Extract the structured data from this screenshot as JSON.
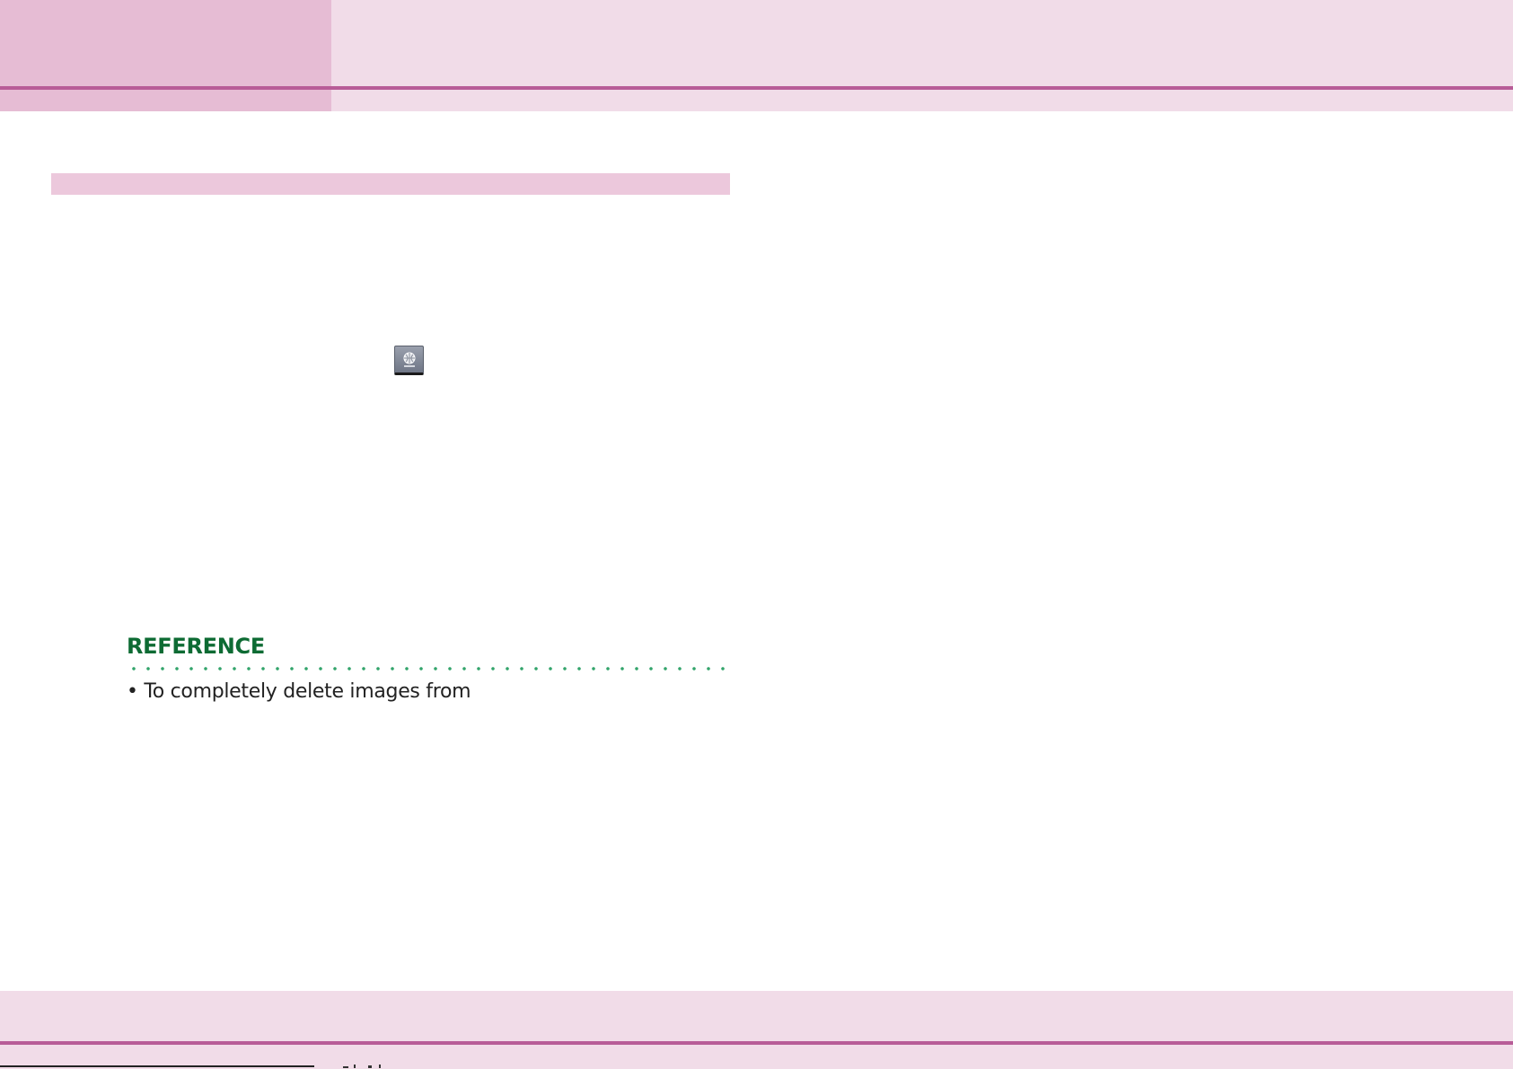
{
  "reference": {
    "heading": "REFERENCE",
    "bullet": "• To completely delete images from"
  },
  "icons": {
    "toolbar_button": "delete-button-icon"
  },
  "colors": {
    "header_left": "#e6bcd4",
    "header_right": "#f1dce8",
    "accent_line": "#b85c97",
    "section_bar": "#ecc8dc",
    "reference_heading": "#0d6b33",
    "reference_dots": "#33a46b"
  }
}
